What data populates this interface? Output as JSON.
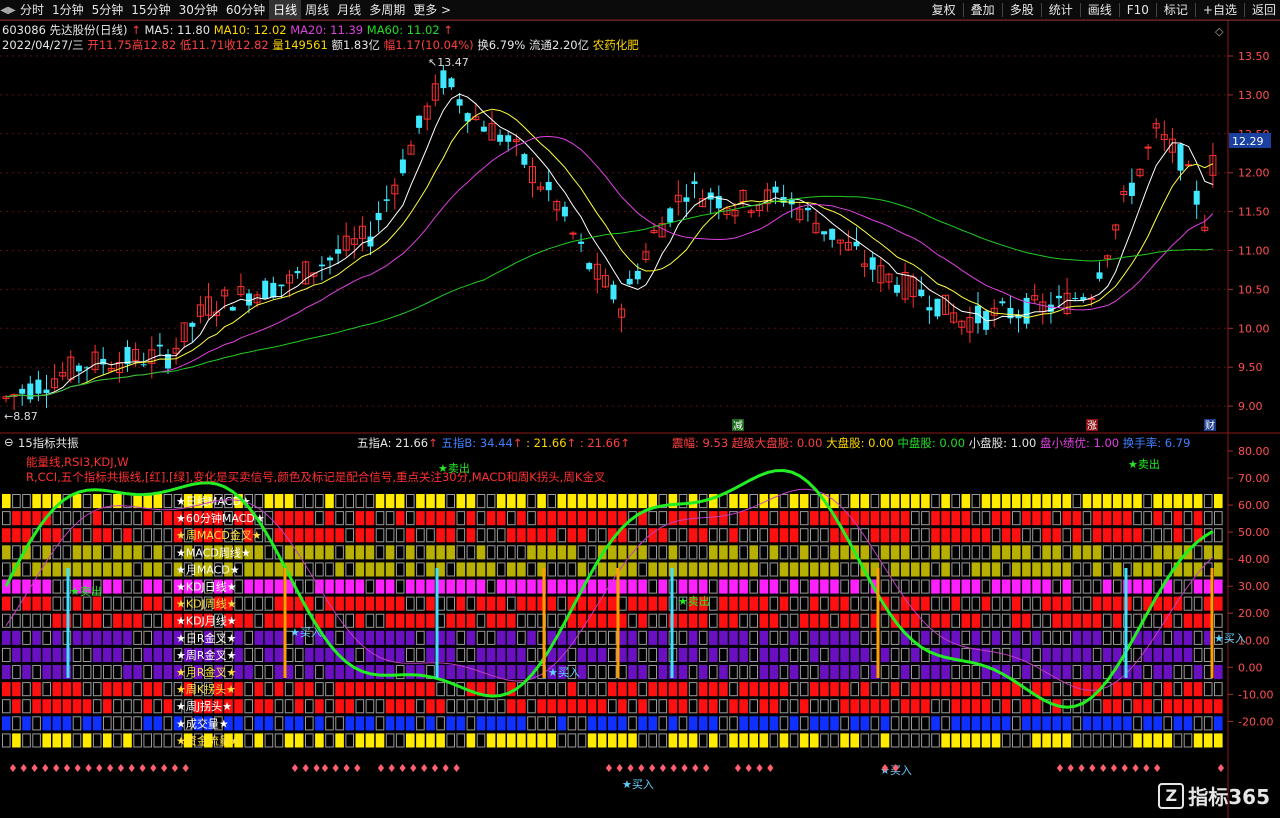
{
  "toolbar": {
    "left_items": [
      "分时",
      "1分钟",
      "5分钟",
      "15分钟",
      "30分钟",
      "60分钟",
      "日线",
      "周线",
      "月线",
      "多周期",
      "更多 >"
    ],
    "active": "日线",
    "right_items": [
      "复权",
      "叠加",
      "多股",
      "统计",
      "画线",
      "F10",
      "标记",
      "+自选",
      "返回"
    ]
  },
  "stock": {
    "code_name": "603086 先达股份(日线)",
    "ma5": "MA5: 11.80",
    "ma10": "MA10: 12.02",
    "ma20": "MA20: 11.39",
    "ma60": "MA60: 11.02",
    "date": "2022/04/27/三",
    "open": "开11.75",
    "high": "高12.82",
    "low": "低11.71",
    "close": "收12.82",
    "volume": "量149561",
    "amount": "额1.83亿",
    "range": "幅1.17(10.04%)",
    "turnover": "换6.79%",
    "float": "流通2.20亿",
    "sector": "农药化肥"
  },
  "price_axis": {
    "labels": [
      "13.50",
      "13.00",
      "12.50",
      "12.00",
      "11.50",
      "11.00",
      "10.50",
      "10.00",
      "9.50",
      "9.00"
    ],
    "current": "12.29",
    "high_mark": "13.47",
    "low_mark": "8.87"
  },
  "markers": {
    "m1": "减",
    "m2": "涨",
    "m3": "财"
  },
  "indicator": {
    "name": "15指标共振",
    "wa": "五指A: 21.66",
    "wb": "五指B: 34.44",
    "v3": ": 21.66",
    "v4": ": 21.66",
    "zhenfu": "震幅: 9.53",
    "chaoji": "超级大盘股: 0.00",
    "dapan": "大盘股: 0.00",
    "zhongpan": "中盘股: 0.00",
    "xiaopan": "小盘股: 1.00",
    "panxiao": "盘小绩优: 1.00",
    "huanshou": "换手率: 6.79",
    "desc1": "能量线,RSI3,KDJ,W",
    "desc2": "R,CCI,五个指标共振线,[红],[绿],变化是买卖信号,颜色及标记是配合信号,重点关注30分,MACD和周K拐头,周K金叉",
    "axis": [
      "80.00",
      "70.00",
      "60.00",
      "50.00",
      "40.00",
      "30.00",
      "20.00",
      "10.00",
      "0.00",
      "-10.00",
      "-20.00"
    ],
    "rows": [
      "★日线MACD★",
      "★60分钟MACD★",
      "★周MACD金叉★",
      "★MACD周线★",
      "★月MACD★",
      "★KDJ日线★",
      "★KDJ周线★",
      "★KDJ月线★",
      "★日R金叉★",
      "★周R金叉★",
      "★月R金叉★",
      "★周K拐头★",
      "★周J拐头★",
      "★成交量★",
      "★资金流量★"
    ],
    "signals": {
      "buy": "买入",
      "sell": "卖出"
    }
  },
  "watermark": "指标365",
  "colors": {
    "up": "#ff3030",
    "down": "#40e8ff",
    "ma5": "#ffffff",
    "ma10": "#ffff40",
    "ma20": "#e040e0",
    "ma60": "#22cc22",
    "yellow_row": "#ffea00",
    "red_row": "#ff1010",
    "olive_row": "#b8b000",
    "magenta_row": "#ff20ff",
    "purple_row": "#6a10c0",
    "blue_row": "#1030ff"
  }
}
